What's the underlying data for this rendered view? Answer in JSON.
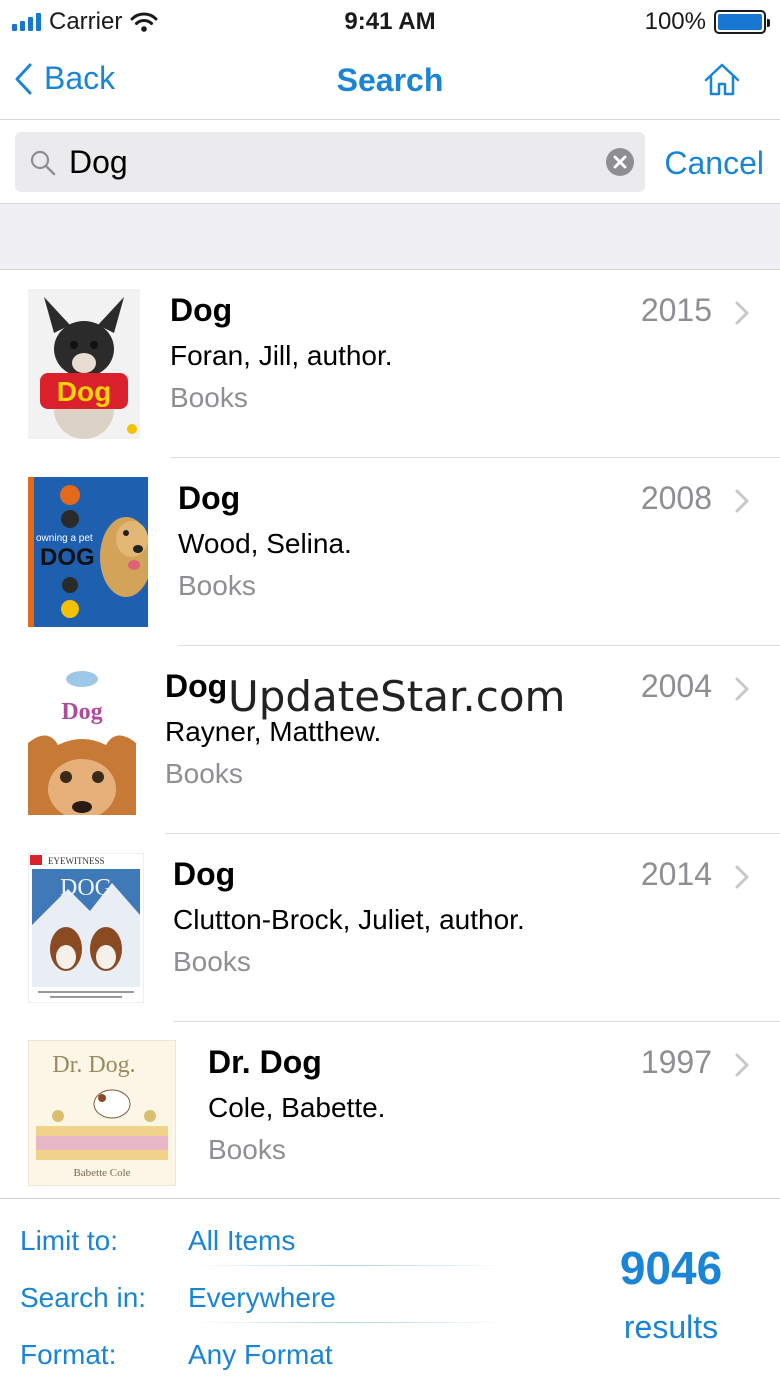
{
  "status_bar": {
    "carrier": "Carrier",
    "time": "9:41 AM",
    "battery_percent": "100%",
    "battery_level": 1.0
  },
  "nav": {
    "back_label": "Back",
    "title": "Search",
    "home_icon": "home-icon"
  },
  "search": {
    "value": "Dog",
    "cancel_label": "Cancel"
  },
  "results": [
    {
      "title": "Dog",
      "author": "Foran, Jill, author.",
      "type": "Books",
      "year": "2015"
    },
    {
      "title": "Dog",
      "author": "Wood, Selina.",
      "type": "Books",
      "year": "2008"
    },
    {
      "title": "Dog",
      "author": "Rayner, Matthew.",
      "type": "Books",
      "year": "2004"
    },
    {
      "title": "Dog",
      "author": "Clutton-Brock, Juliet, author.",
      "type": "Books",
      "year": "2014"
    },
    {
      "title": "Dr. Dog",
      "author": "Cole, Babette.",
      "type": "Books",
      "year": "1997"
    }
  ],
  "watermark": "UpdateStar.com",
  "filters": {
    "limit_label": "Limit to:",
    "limit_value": "All Items",
    "search_in_label": "Search in:",
    "search_in_value": "Everywhere",
    "format_label": "Format:",
    "format_value": "Any Format"
  },
  "summary": {
    "count": "9046",
    "count_label": "results"
  },
  "colors": {
    "accent": "#1a85d6",
    "secondary_text": "#8e8e93",
    "section_bg": "#efeff4"
  }
}
